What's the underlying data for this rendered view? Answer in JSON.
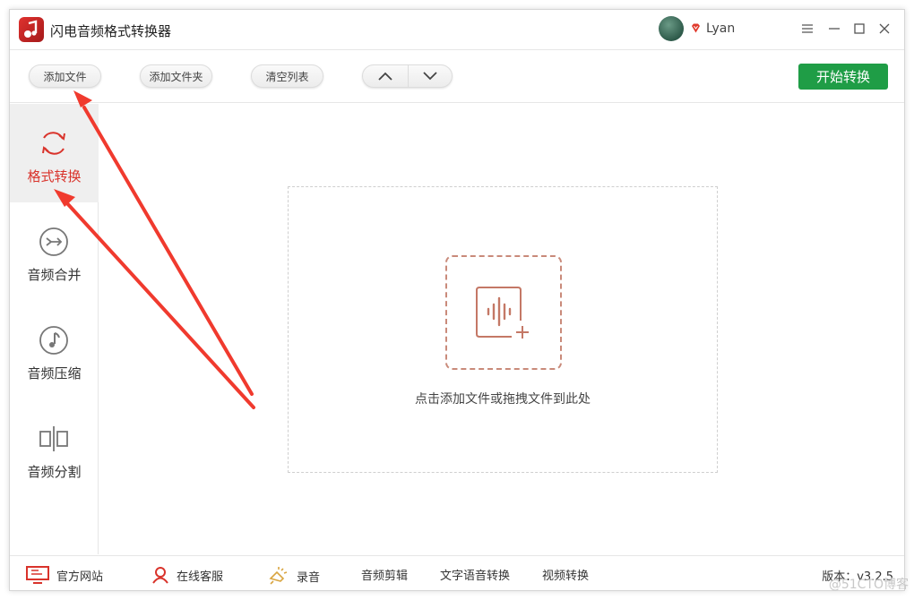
{
  "app": {
    "title": "闪电音频格式转换器",
    "user": "Lyan"
  },
  "toolbar": {
    "add_file": "添加文件",
    "add_folder": "添加文件夹",
    "clear_list": "清空列表",
    "start_convert": "开始转换"
  },
  "sidebar": {
    "items": [
      {
        "label": "格式转换",
        "icon": "refresh-icon",
        "active": true
      },
      {
        "label": "音频合并",
        "icon": "merge-icon",
        "active": false
      },
      {
        "label": "音频压缩",
        "icon": "music-note-icon",
        "active": false
      },
      {
        "label": "音频分割",
        "icon": "split-icon",
        "active": false
      }
    ]
  },
  "dropzone": {
    "text": "点击添加文件或拖拽文件到此处"
  },
  "statusbar": {
    "official_site": "官方网站",
    "online_service": "在线客服",
    "record": "录音",
    "audio_cut": "音频剪辑",
    "tts": "文字语音转换",
    "video_convert": "视频转换",
    "version": "版本：v3.2.5"
  },
  "watermark": "@51CTO博客",
  "colors": {
    "accent_red": "#d9332b",
    "start_green": "#1f9d46",
    "annotation_arrow": "#f03a2e"
  }
}
